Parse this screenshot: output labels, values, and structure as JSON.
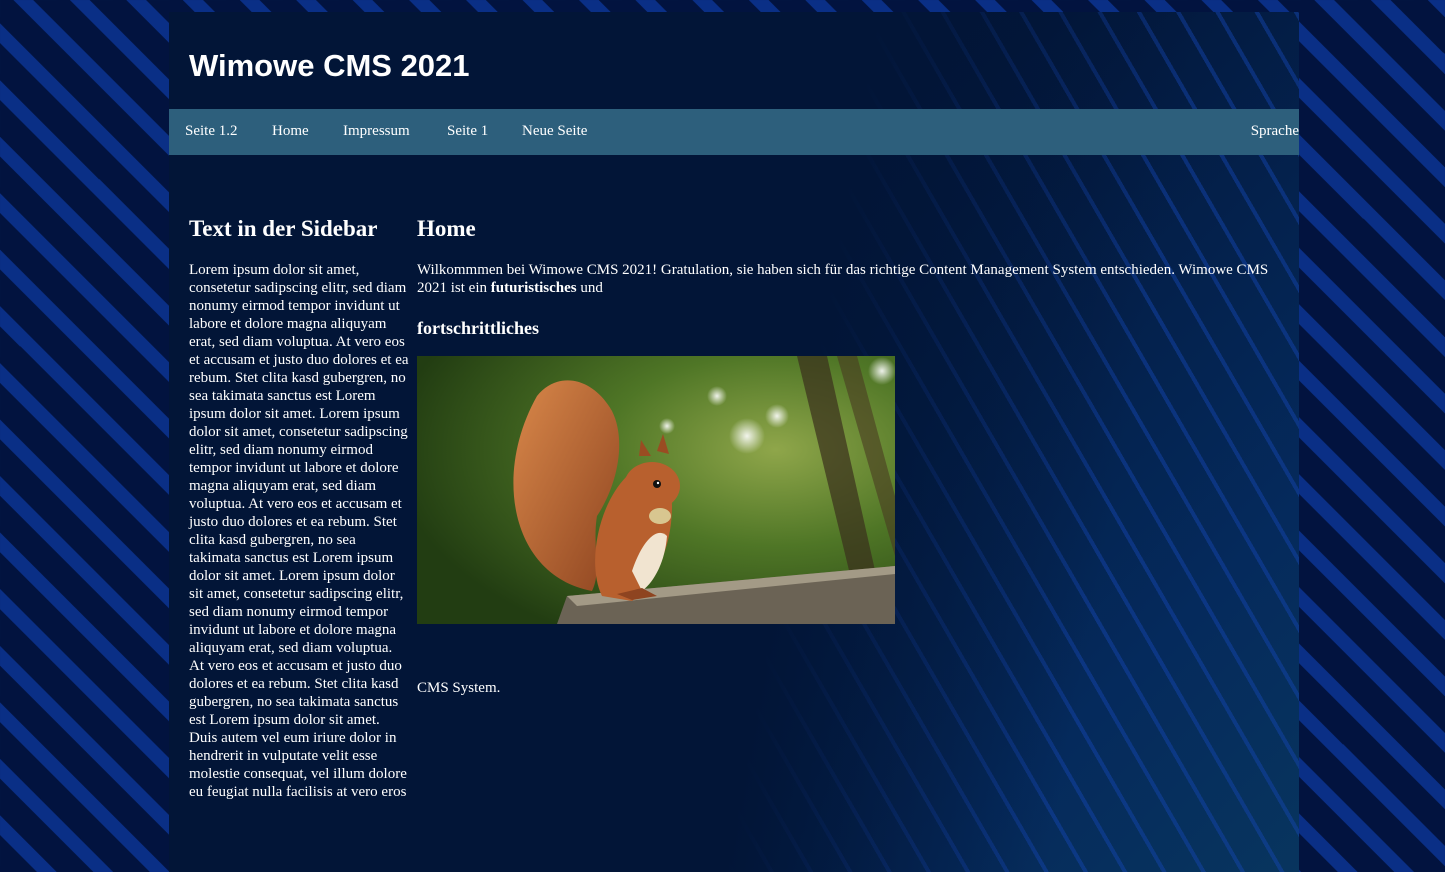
{
  "header": {
    "site_title": "Wimowe CMS 2021"
  },
  "nav": {
    "items": [
      {
        "label": "Seite 1.2"
      },
      {
        "label": "Home"
      },
      {
        "label": "Impressum"
      },
      {
        "label": "Seite 1"
      },
      {
        "label": "Neue Seite"
      }
    ],
    "language_label": "Sprache"
  },
  "sidebar": {
    "heading": "Text in der Sidebar",
    "text": "Lorem ipsum dolor sit amet, consetetur sadipscing elitr, sed diam nonumy eirmod tempor invidunt ut labore et dolore magna aliquyam erat, sed diam voluptua. At vero eos et accusam et justo duo dolores et ea rebum. Stet clita kasd gubergren, no sea takimata sanctus est Lorem ipsum dolor sit amet. Lorem ipsum dolor sit amet, consetetur sadipscing elitr, sed diam nonumy eirmod tempor invidunt ut labore et dolore magna aliquyam erat, sed diam voluptua. At vero eos et accusam et justo duo dolores et ea rebum. Stet clita kasd gubergren, no sea takimata sanctus est Lorem ipsum dolor sit amet. Lorem ipsum dolor sit amet, consetetur sadipscing elitr, sed diam nonumy eirmod tempor invidunt ut labore et dolore magna aliquyam erat, sed diam voluptua. At vero eos et accusam et justo duo dolores et ea rebum. Stet clita kasd gubergren, no sea takimata sanctus est Lorem ipsum dolor sit amet. Duis autem vel eum iriure dolor in hendrerit in vulputate velit esse molestie consequat, vel illum dolore eu feugiat nulla facilisis at vero eros"
  },
  "content": {
    "heading": "Home",
    "intro_text": "Wilkommmen bei Wimowe CMS 2021! Gratulation, sie haben sich für das richtige Content Management System entschieden. Wimowe CMS 2021 ist ein ",
    "intro_bold": "futuristisches",
    "intro_after": " und",
    "subheading": "fortschrittliches",
    "outro_text": "CMS System."
  },
  "colors": {
    "nav_bar": "#2d5f7c",
    "page_bg": "#021537",
    "body_stripes": "#0a2f86",
    "text": "#ffffff"
  }
}
